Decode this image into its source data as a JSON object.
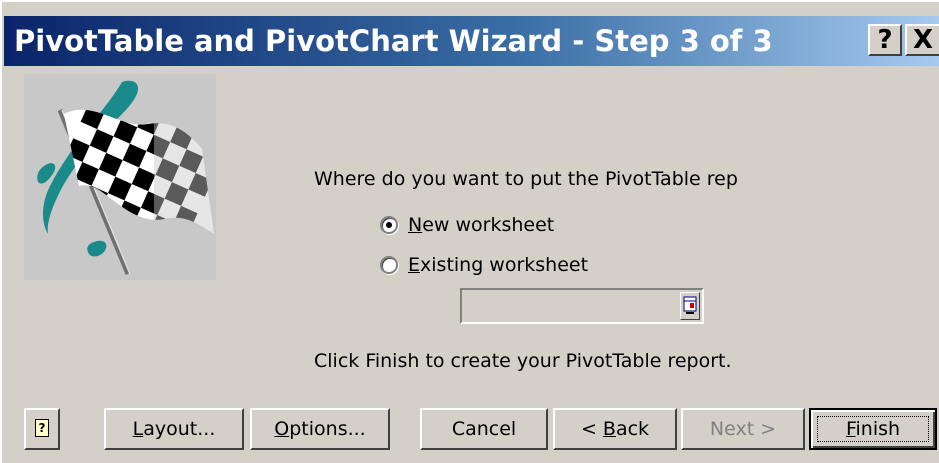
{
  "window": {
    "title": "PivotTable and PivotChart Wizard - Step 3 of 3",
    "help_button": "?",
    "close_button": "X"
  },
  "image": {
    "icon": "checkered-flag-icon",
    "colors": {
      "swoosh": "#1a8a8a",
      "background": "#c8c8c8"
    }
  },
  "prompt": "Where do you want to put the PivotTable rep",
  "options": {
    "new_worksheet": {
      "accel": "N",
      "rest": "ew worksheet",
      "checked": true
    },
    "existing_worksheet": {
      "accel": "E",
      "rest": "xisting worksheet",
      "checked": false
    }
  },
  "range_field": {
    "value": "",
    "picker_icon": "range-select-icon"
  },
  "finish_hint": "Click Finish to create your PivotTable report.",
  "buttons": {
    "help_icon": "help-icon",
    "layout": {
      "accel": "L",
      "rest": "ayout..."
    },
    "options": {
      "accel": "O",
      "rest": "ptions..."
    },
    "cancel": "Cancel",
    "back": {
      "prefix": "< ",
      "accel": "B",
      "rest": "ack"
    },
    "next": "Next >",
    "finish": {
      "accel": "F",
      "rest": "inish"
    }
  }
}
